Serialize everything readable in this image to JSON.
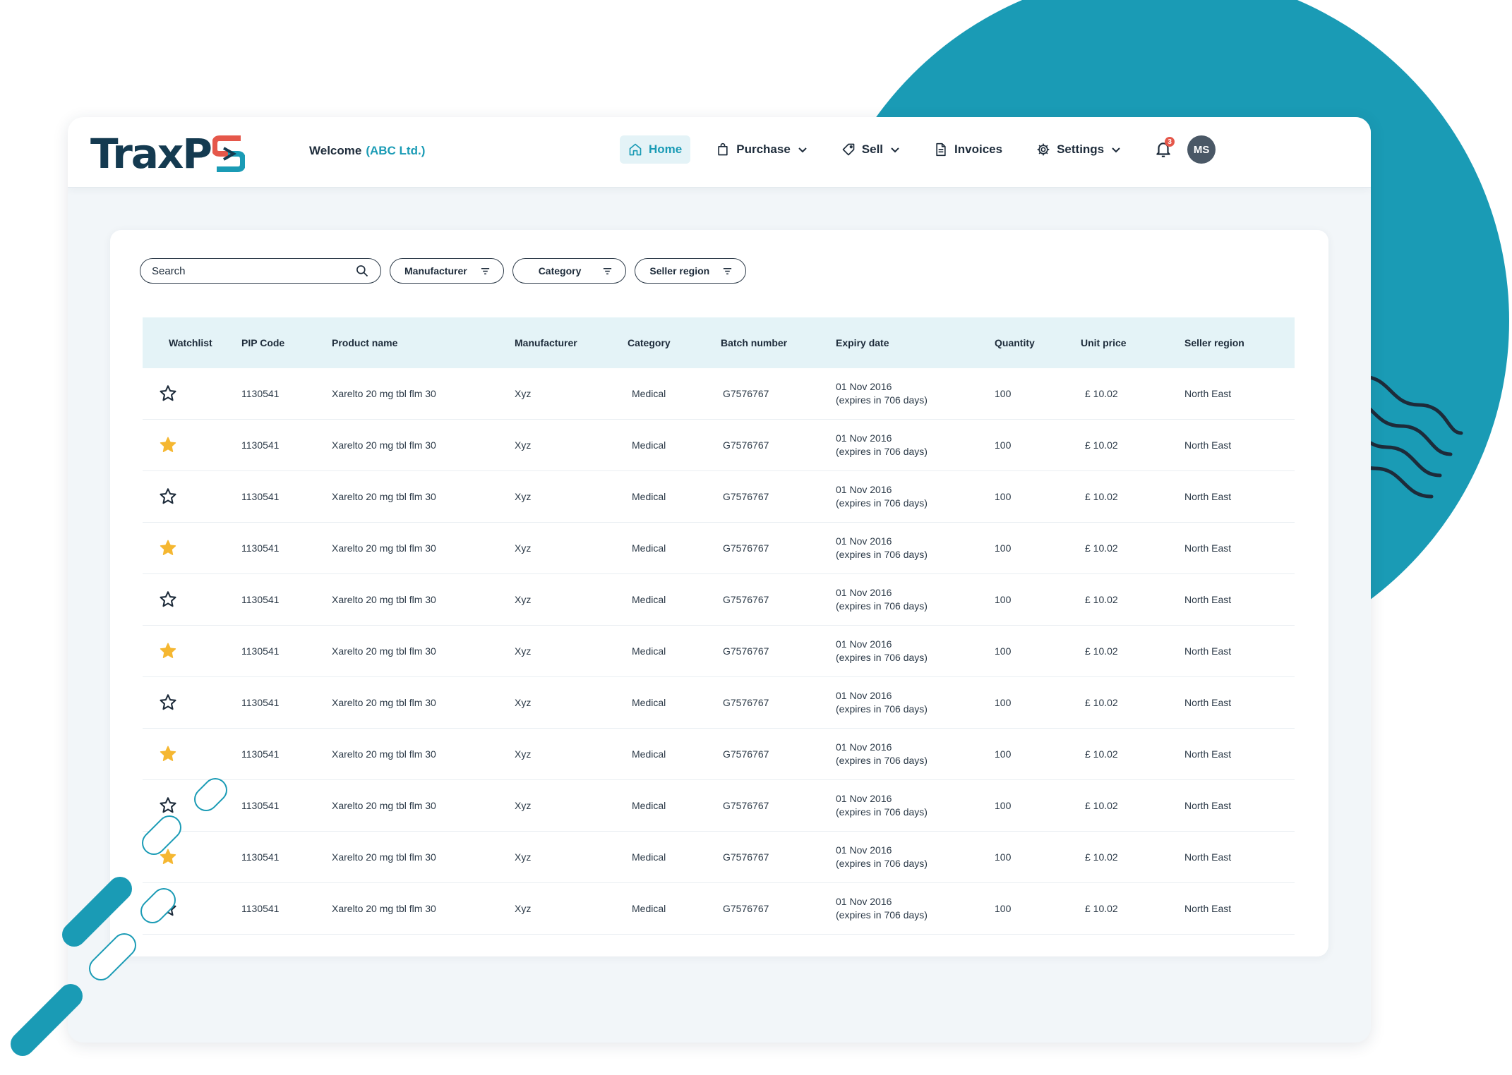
{
  "brand": {
    "logo_text": "TraxP",
    "logo_mark_letter": "S",
    "colors": {
      "primary": "#1a9bb5",
      "dark": "#143a50",
      "accent_red": "#e5574a",
      "star_filled": "#f5b731"
    }
  },
  "header": {
    "welcome_label": "Welcome",
    "company": "(ABC Ltd.)"
  },
  "nav": {
    "items": [
      {
        "label": "Home",
        "icon": "home-icon",
        "active": true,
        "has_dropdown": false
      },
      {
        "label": "Purchase",
        "icon": "shopping-bag-icon",
        "active": false,
        "has_dropdown": true
      },
      {
        "label": "Sell",
        "icon": "tag-icon",
        "active": false,
        "has_dropdown": true
      },
      {
        "label": "Invoices",
        "icon": "document-icon",
        "active": false,
        "has_dropdown": false
      },
      {
        "label": "Settings",
        "icon": "gear-icon",
        "active": false,
        "has_dropdown": true
      }
    ],
    "notifications_count": "3",
    "avatar_initials": "MS"
  },
  "filters": {
    "search_placeholder": "Search",
    "manufacturer_label": "Manufacturer",
    "category_label": "Category",
    "seller_region_label": "Seller region"
  },
  "table": {
    "headers": {
      "watchlist": "Watchlist",
      "pip": "PIP Code",
      "name": "Product name",
      "manufacturer": "Manufacturer",
      "category": "Category",
      "batch": "Batch number",
      "expiry": "Expiry date",
      "quantity": "Quantity",
      "price": "Unit price",
      "region": "Seller region"
    },
    "rows": [
      {
        "watch": false,
        "pip": "1130541",
        "name": "Xarelto 20 mg tbl flm 30",
        "manufacturer": "Xyz",
        "category": "Medical",
        "batch": "G7576767",
        "expiry_date": "01 Nov 2016",
        "expiry_note": "(expires in 706 days)",
        "quantity": "100",
        "price": "£ 10.02",
        "region": "North East"
      },
      {
        "watch": true,
        "pip": "1130541",
        "name": "Xarelto 20 mg tbl flm 30",
        "manufacturer": "Xyz",
        "category": "Medical",
        "batch": "G7576767",
        "expiry_date": "01 Nov 2016",
        "expiry_note": "(expires in 706 days)",
        "quantity": "100",
        "price": "£ 10.02",
        "region": "North East"
      },
      {
        "watch": false,
        "pip": "1130541",
        "name": "Xarelto 20 mg tbl flm 30",
        "manufacturer": "Xyz",
        "category": "Medical",
        "batch": "G7576767",
        "expiry_date": "01 Nov 2016",
        "expiry_note": "(expires in 706 days)",
        "quantity": "100",
        "price": "£ 10.02",
        "region": "North East"
      },
      {
        "watch": true,
        "pip": "1130541",
        "name": "Xarelto 20 mg tbl flm 30",
        "manufacturer": "Xyz",
        "category": "Medical",
        "batch": "G7576767",
        "expiry_date": "01 Nov 2016",
        "expiry_note": "(expires in 706 days)",
        "quantity": "100",
        "price": "£ 10.02",
        "region": "North East"
      },
      {
        "watch": false,
        "pip": "1130541",
        "name": "Xarelto 20 mg tbl flm 30",
        "manufacturer": "Xyz",
        "category": "Medical",
        "batch": "G7576767",
        "expiry_date": "01 Nov 2016",
        "expiry_note": "(expires in 706 days)",
        "quantity": "100",
        "price": "£ 10.02",
        "region": "North East"
      },
      {
        "watch": true,
        "pip": "1130541",
        "name": "Xarelto 20 mg tbl flm 30",
        "manufacturer": "Xyz",
        "category": "Medical",
        "batch": "G7576767",
        "expiry_date": "01 Nov 2016",
        "expiry_note": "(expires in 706 days)",
        "quantity": "100",
        "price": "£ 10.02",
        "region": "North East"
      },
      {
        "watch": false,
        "pip": "1130541",
        "name": "Xarelto 20 mg tbl flm 30",
        "manufacturer": "Xyz",
        "category": "Medical",
        "batch": "G7576767",
        "expiry_date": "01 Nov 2016",
        "expiry_note": "(expires in 706 days)",
        "quantity": "100",
        "price": "£ 10.02",
        "region": "North East"
      },
      {
        "watch": true,
        "pip": "1130541",
        "name": "Xarelto 20 mg tbl flm 30",
        "manufacturer": "Xyz",
        "category": "Medical",
        "batch": "G7576767",
        "expiry_date": "01 Nov 2016",
        "expiry_note": "(expires in 706 days)",
        "quantity": "100",
        "price": "£ 10.02",
        "region": "North East"
      },
      {
        "watch": false,
        "pip": "1130541",
        "name": "Xarelto 20 mg tbl flm 30",
        "manufacturer": "Xyz",
        "category": "Medical",
        "batch": "G7576767",
        "expiry_date": "01 Nov 2016",
        "expiry_note": "(expires in 706 days)",
        "quantity": "100",
        "price": "£ 10.02",
        "region": "North East"
      },
      {
        "watch": true,
        "pip": "1130541",
        "name": "Xarelto 20 mg tbl flm 30",
        "manufacturer": "Xyz",
        "category": "Medical",
        "batch": "G7576767",
        "expiry_date": "01 Nov 2016",
        "expiry_note": "(expires in 706 days)",
        "quantity": "100",
        "price": "£ 10.02",
        "region": "North East"
      },
      {
        "watch": false,
        "pip": "1130541",
        "name": "Xarelto 20 mg tbl flm 30",
        "manufacturer": "Xyz",
        "category": "Medical",
        "batch": "G7576767",
        "expiry_date": "01 Nov 2016",
        "expiry_note": "(expires in 706 days)",
        "quantity": "100",
        "price": "£ 10.02",
        "region": "North East"
      }
    ]
  }
}
